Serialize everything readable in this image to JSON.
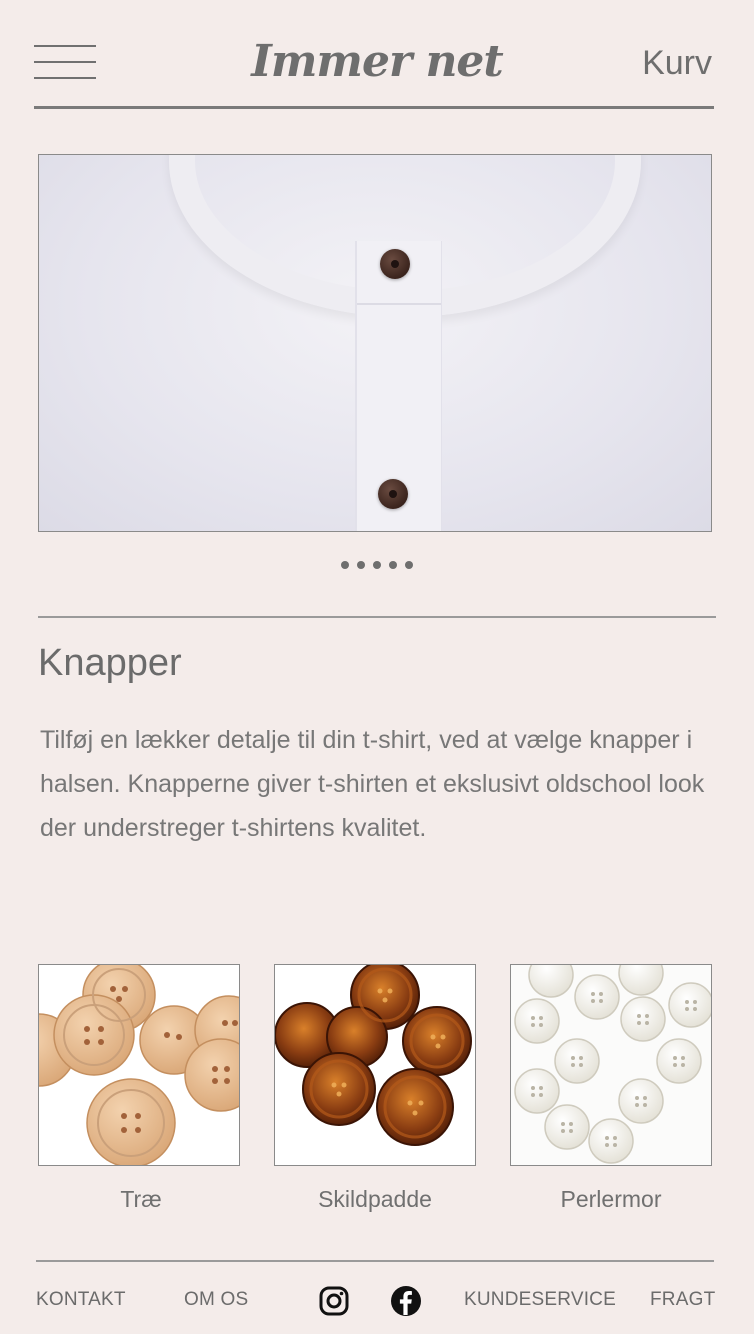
{
  "header": {
    "brand": "Immer net",
    "cart_label": "Kurv",
    "menu_icon": "hamburger-menu-icon"
  },
  "hero": {
    "image_subject": "white t-shirt collar with dark buttons",
    "carousel_dots": 5
  },
  "section": {
    "title": "Knapper",
    "body": "Tilføj en lækker detalje til din t-shirt, ved at vælge knapper i halsen. Knapperne giver t-shirten et ekslusivt oldschool look der understreger t-shirtens kvalitet."
  },
  "options": [
    {
      "label": "Træ",
      "color": "#e3b98c"
    },
    {
      "label": "Skildpadde",
      "color": "#8a3d12"
    },
    {
      "label": "Perlermor",
      "color": "#f1efe6"
    }
  ],
  "footer": {
    "links": [
      "KONTAKT",
      "OM OS",
      "KUNDESERVICE",
      "FRAGT"
    ],
    "social_icons": [
      "instagram-icon",
      "facebook-icon"
    ]
  },
  "colors": {
    "background": "#f4ecea",
    "text": "#6b6b6b",
    "rule": "#7a7a7a"
  }
}
